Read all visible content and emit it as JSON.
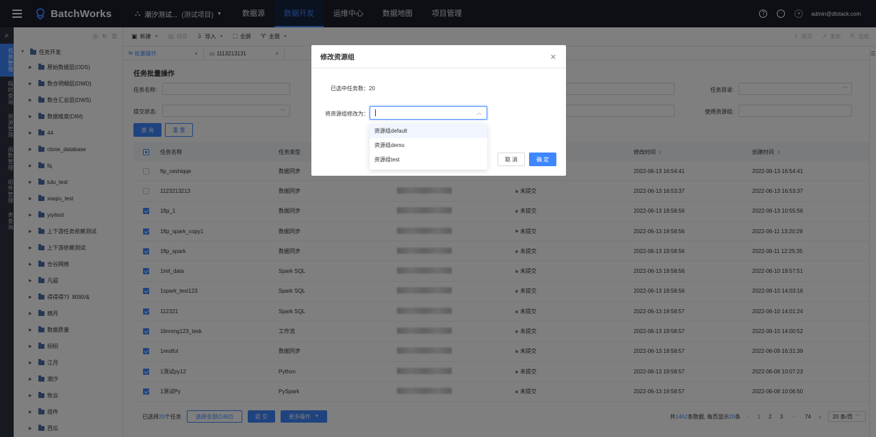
{
  "app": {
    "name": "BatchWorks",
    "project_name": "潮汐测试...",
    "project_tag": "(测试项目)"
  },
  "nav": [
    "数据源",
    "数据开发",
    "运维中心",
    "数据地图",
    "项目管理"
  ],
  "user": {
    "email": "admin@dtstack.com"
  },
  "rail": [
    "任务管理",
    "临时查询",
    "资源管理",
    "函数管理",
    "组件管理",
    "表查询"
  ],
  "tree": {
    "root": "任务开发",
    "items": [
      "原始数据层(ODS)",
      "数仓明细层(DWD)",
      "数仓汇总层(DWS)",
      "数据维度(DIM)",
      "44",
      "clone_database",
      "fq",
      "lulu_test",
      "xiaqiu_test",
      "yiyitest",
      "上下游任务依赖测试",
      "上下游依赖测试",
      "仓谷网络",
      "凡超",
      "得得得?》8090/&",
      "摘月",
      "数据质量",
      "栩栩",
      "江月",
      "潮汐",
      "牧云",
      "组件",
      "西瓜"
    ]
  },
  "toolbar": {
    "new": "新建",
    "save": "保存",
    "import": "导入",
    "fullscreen": "全屏",
    "theme": "主题",
    "submit": "提交",
    "publish": "发布",
    "ops": "运维"
  },
  "tabs": [
    {
      "label": "批量操作"
    },
    {
      "label": "1113213131"
    }
  ],
  "page": {
    "title": "任务批量操作",
    "filters": {
      "task_name": "任务名称:",
      "submit_status": "提交状态:",
      "task_dir": "任务目录:",
      "resource_group": "使用资源组:"
    },
    "query_btn": "查 询",
    "reset_btn": "重 置"
  },
  "table": {
    "headers": [
      "任务名称",
      "任务类型",
      "",
      "",
      "修改时间",
      "创建时间"
    ],
    "rows": [
      {
        "checked": false,
        "name": "ftp_ceshiqqe",
        "type": "数据同步",
        "status": "",
        "modified": "2022-06-13 16:54:41",
        "created": "2022-06-13 16:54:41"
      },
      {
        "checked": false,
        "name": "1123213213",
        "type": "数据同步",
        "status": "未提交",
        "modified": "2022-06-13 16:53:37",
        "created": "2022-06-13 16:53:37"
      },
      {
        "checked": true,
        "name": "1ftp_1",
        "type": "数据同步",
        "status": "未提交",
        "modified": "2022-06-13 19:58:56",
        "created": "2022-06-13 10:55:56"
      },
      {
        "checked": true,
        "name": "1ftp_spark_copy1",
        "type": "数据同步",
        "status": "未提交",
        "modified": "2022-06-13 19:58:56",
        "created": "2022-06-11 13:20:29"
      },
      {
        "checked": true,
        "name": "1ftp_spark",
        "type": "数据同步",
        "status": "未提交",
        "modified": "2022-06-13 19:58:56",
        "created": "2022-06-11 12:25:35"
      },
      {
        "checked": true,
        "name": "1init_data",
        "type": "Spark SQL",
        "status": "未提交",
        "modified": "2022-06-13 19:58:56",
        "created": "2022-06-10 19:57:51"
      },
      {
        "checked": true,
        "name": "1spark_test123",
        "type": "Spark SQL",
        "status": "未提交",
        "modified": "2022-06-13 19:58:56",
        "created": "2022-06-10 14:03:16"
      },
      {
        "checked": true,
        "name": "112321",
        "type": "Spark SQL",
        "status": "未提交",
        "modified": "2022-06-13 19:58:57",
        "created": "2022-06-10 14:01:24"
      },
      {
        "checked": true,
        "name": "1linrong123_tesk",
        "type": "工作流",
        "status": "未提交",
        "modified": "2022-06-13 19:58:57",
        "created": "2022-06-10 14:00:52"
      },
      {
        "checked": true,
        "name": "1restful",
        "type": "数据同步",
        "status": "未提交",
        "modified": "2022-06-13 19:58:57",
        "created": "2022-06-09 16:31:39"
      },
      {
        "checked": true,
        "name": "1测试py12",
        "type": "Python",
        "status": "未提交",
        "modified": "2022-06-13 19:58:57",
        "created": "2022-06-08 10:07:23"
      },
      {
        "checked": true,
        "name": "1测试Py",
        "type": "PySpark",
        "status": "未提交",
        "modified": "2022-06-13 19:58:57",
        "created": "2022-06-08 10:06:50"
      }
    ]
  },
  "footer": {
    "selected_prefix": "已选择",
    "selected_count": "20",
    "selected_suffix": "个任务",
    "select_all": "选择全部(1462)",
    "submit": "提 交",
    "more": "更多操作",
    "total_prefix": "共",
    "total": "1462",
    "total_mid": "条数据, 每页显示",
    "per_page": "20",
    "total_suffix": "条",
    "pages": [
      "1",
      "2",
      "3",
      "···",
      "74"
    ],
    "page_size": "20 条/页"
  },
  "modal": {
    "title": "修改资源组",
    "selected_label": "已选中任务数：",
    "selected_value": "20",
    "change_label": "将资源组修改为：",
    "options": [
      "资源组default",
      "资源组demo",
      "资源组test"
    ],
    "cancel": "取 消",
    "ok": "确 定"
  }
}
